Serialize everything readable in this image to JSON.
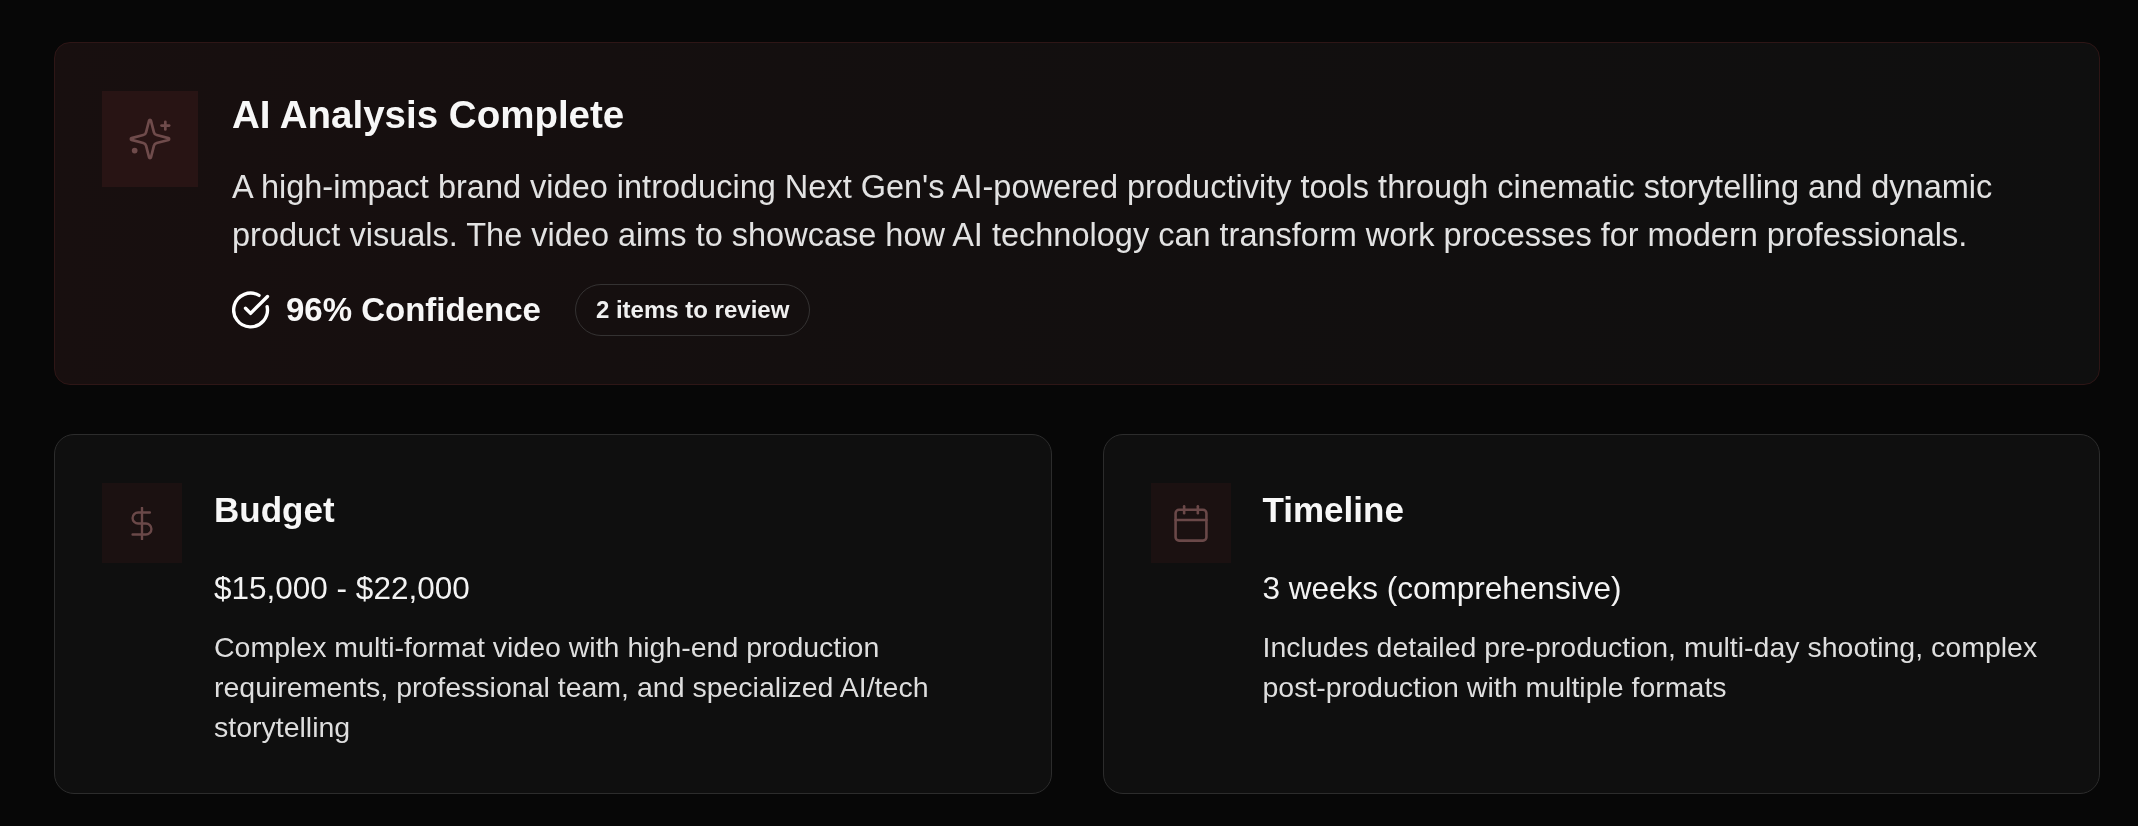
{
  "analysis": {
    "title": "AI Analysis Complete",
    "summary": "A high-impact brand video introducing Next Gen's AI-powered productivity tools through cinematic storytelling and dynamic product visuals. The video aims to showcase how AI technology can transform work processes for modern professionals.",
    "confidence": "96% Confidence",
    "review_badge": "2 items to review"
  },
  "cards": [
    {
      "kind": "budget",
      "title": "Budget",
      "value": "$15,000 - $22,000",
      "description": "Complex multi-format video with high-end production requirements, professional team, and specialized AI/tech storytelling"
    },
    {
      "kind": "timeline",
      "title": "Timeline",
      "value": "3 weeks (comprehensive)",
      "description": "Includes detailed pre-production, multi-day shooting, complex post-production with multiple formats"
    }
  ]
}
